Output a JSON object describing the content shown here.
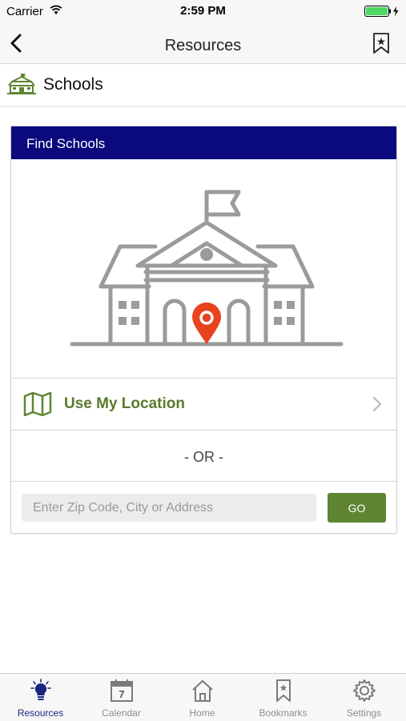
{
  "status_bar": {
    "carrier": "Carrier",
    "time": "2:59 PM"
  },
  "nav": {
    "title": "Resources"
  },
  "section": {
    "title": "Schools"
  },
  "card": {
    "header": "Find Schools",
    "use_location_label": "Use My Location",
    "or_label": "- OR -",
    "search_placeholder": "Enter Zip Code, City or Address",
    "go_label": "GO"
  },
  "tabs": [
    {
      "label": "Resources",
      "icon": "lightbulb-icon",
      "active": true
    },
    {
      "label": "Calendar",
      "icon": "calendar-icon",
      "active": false,
      "day": "7"
    },
    {
      "label": "Home",
      "icon": "home-icon",
      "active": false
    },
    {
      "label": "Bookmarks",
      "icon": "bookmark-icon",
      "active": false
    },
    {
      "label": "Settings",
      "icon": "gear-icon",
      "active": false
    }
  ],
  "colors": {
    "card_header": "#0a0a7e",
    "accent_green": "#5f8533",
    "pin_red": "#e8421e",
    "active_tab": "#1a2580",
    "battery": "#4cd964"
  }
}
